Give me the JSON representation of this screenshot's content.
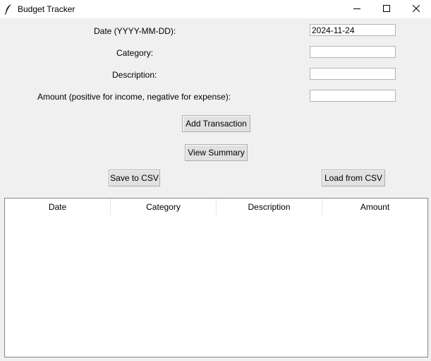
{
  "window": {
    "title": "Budget Tracker",
    "icons": {
      "app": "feather-icon",
      "minimize": "minimize-icon",
      "maximize": "maximize-icon",
      "close": "close-icon"
    }
  },
  "form": {
    "date_label": "Date (YYYY-MM-DD):",
    "date_value": "2024-11-24",
    "category_label": "Category:",
    "category_value": "",
    "description_label": "Description:",
    "description_value": "",
    "amount_label": "Amount (positive for income, negative for expense):",
    "amount_value": ""
  },
  "buttons": {
    "add": "Add Transaction",
    "summary": "View Summary",
    "save": "Save to CSV",
    "load": "Load from CSV"
  },
  "table": {
    "columns": [
      "Date",
      "Category",
      "Description",
      "Amount"
    ],
    "rows": []
  }
}
